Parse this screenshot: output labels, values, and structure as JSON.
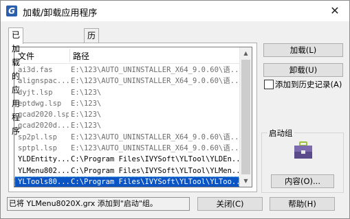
{
  "window": {
    "title": "加载/卸载应用程序",
    "app_icon_letter": "G"
  },
  "tabs": [
    {
      "label": "已加载的应用程序",
      "active": true
    },
    {
      "label": "历史记录列表",
      "active": false
    }
  ],
  "list": {
    "columns": {
      "file": "文件",
      "path": "路径"
    },
    "rows": [
      {
        "file": "ai3d.fas",
        "path": "E:\\123\\AUTO_UNINSTALLER_X64_9.0.60\\语...",
        "style": "grey"
      },
      {
        "file": "alignspac...",
        "path": "E:\\123\\AUTO_UNINSTALLER_X64_9.0.60\\语...",
        "style": "grey"
      },
      {
        "file": "dyjt.lsp",
        "path": "E:\\123\\",
        "style": "grey"
      },
      {
        "file": "eptdwg.lsp",
        "path": "E:\\123\\",
        "style": "grey"
      },
      {
        "file": "gcad2020.lsp",
        "path": "E:\\123\\",
        "style": "grey"
      },
      {
        "file": "gcad2020d...",
        "path": "E:\\123\\",
        "style": "grey"
      },
      {
        "file": "sp2pl.lsp",
        "path": "E:\\123\\AUTO_UNINSTALLER_X64_9.0.60\\语...",
        "style": "grey"
      },
      {
        "file": "sptpl.lsp",
        "path": "E:\\123\\AUTO_UNINSTALLER_X64_9.0.60\\语...",
        "style": "grey"
      },
      {
        "file": "YLDEntity...",
        "path": "C:\\Program Files\\IVYSoft\\YLTool\\YLDEn...",
        "style": "normal"
      },
      {
        "file": "YLMenu802...",
        "path": "C:\\Program Files\\IVYSoft\\YLTool\\YLMen...",
        "style": "normal"
      },
      {
        "file": "YLTools80...",
        "path": "C:\\Program Files\\IVYSoft\\YLTool\\YLToo...",
        "style": "selected"
      }
    ]
  },
  "buttons": {
    "load": "加载(L)",
    "unload": "卸载(U)",
    "contents": "内容(O)...",
    "close": "关闭(C)",
    "help": "帮助(H)"
  },
  "history_checkbox": {
    "label": "添加到历史记录(A)",
    "checked": false
  },
  "startup_group": {
    "title": "启动组"
  },
  "status": "已将 YLMenu8020X.grx 添加到\"启动\"组。",
  "colors": {
    "selection": "#0a54c4",
    "briefcase_body": "#5a4a8a",
    "briefcase_handle": "#9ac23c"
  }
}
